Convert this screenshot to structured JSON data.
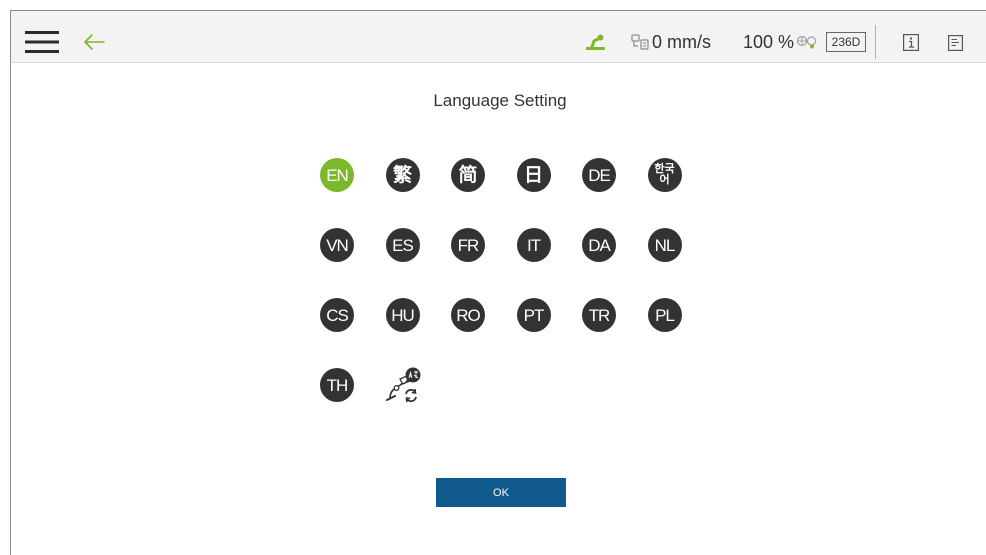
{
  "header": {
    "menu_icon": "hamburger-menu-icon",
    "back_icon": "back-arrow-icon",
    "robot_status_icon": "robot-arm-icon",
    "speed_icon": "speed-icon",
    "speed": "0 mm/s",
    "speed_percentage": "100 %",
    "status_icon": "safety-status-icon",
    "robot_id": "236D",
    "info_icon": "info-icon",
    "log_icon": "log-icon"
  },
  "page": {
    "title": "Language Setting",
    "ok_label": "OK"
  },
  "languages": [
    {
      "label": "EN",
      "selected": true
    },
    {
      "label": "繁"
    },
    {
      "label": "简"
    },
    {
      "label": "日"
    },
    {
      "label": "DE"
    },
    {
      "label": "한국어"
    },
    {
      "label": "VN"
    },
    {
      "label": "ES"
    },
    {
      "label": "FR"
    },
    {
      "label": "IT"
    },
    {
      "label": "DA"
    },
    {
      "label": "NL"
    },
    {
      "label": "CS"
    },
    {
      "label": "HU"
    },
    {
      "label": "RO"
    },
    {
      "label": "PT"
    },
    {
      "label": "TR"
    },
    {
      "label": "PL"
    },
    {
      "label": "TH"
    }
  ],
  "custom_language": {
    "icon": "custom-language-icon"
  },
  "colors": {
    "accent": "#7ab92a",
    "circle": "#333333",
    "ok_button": "#0f5a8b",
    "header_bg": "#f3f3f3"
  }
}
